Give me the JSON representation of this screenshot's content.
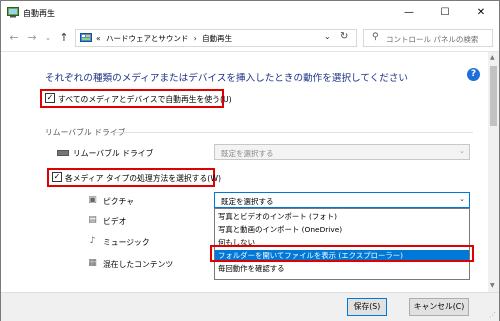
{
  "window": {
    "title": "自動再生",
    "minimize_glyph": "—",
    "maximize_glyph": "☐",
    "close_glyph": "✕"
  },
  "nav": {
    "back_glyph": "←",
    "forward_glyph": "→",
    "recent_glyph": "⌄",
    "up_glyph": "↑",
    "crumb_prefix": "«",
    "crumb_1": "ハードウェアとサウンド",
    "crumb_sep": "›",
    "crumb_2": "自動再生",
    "dropdown_glyph": "⌄",
    "refresh_glyph": "↻",
    "search_placeholder": "コントロール パネルの検索",
    "search_glyph": "⚲"
  },
  "main": {
    "heading": "それぞれの種類のメディアまたはデバイスを挿入したときの動作を選択してください",
    "help_glyph": "?",
    "use_autoplay": {
      "label": "すべてのメディアとデバイスで自動再生を使う(U)",
      "checked": "✓"
    },
    "section_title": "リムーバブル ドライブ",
    "removable_drive": {
      "label": "リムーバブル ドライブ",
      "value": "既定を選択する"
    },
    "per_type": {
      "label": "各メディア タイプの処理方法を選択する(W)",
      "checked": "✓"
    },
    "media_rows": [
      {
        "label": "ピクチャ",
        "icon": "▣"
      },
      {
        "label": "ビデオ",
        "icon": "▤"
      },
      {
        "label": "ミュージック",
        "icon": "♪"
      },
      {
        "label": "混在したコンテンツ",
        "icon": "▦"
      }
    ],
    "pictures_combo_value": "既定を選択する",
    "combo_arrow": "⌄",
    "dropdown_options": [
      "写真とビデオのインポート (フォト)",
      "写真と動画のインポート (OneDrive)",
      "何もしない",
      "フォルダーを開いてファイルを表示 (エクスプローラー)",
      "毎回動作を確認する"
    ],
    "selected_option_index": 3
  },
  "footer": {
    "save_label": "保存(S)",
    "cancel_label": "キャンセル(C)"
  },
  "colors": {
    "heading": "#1e3287",
    "highlight_box": "#e00000",
    "selection": "#0078d7"
  }
}
